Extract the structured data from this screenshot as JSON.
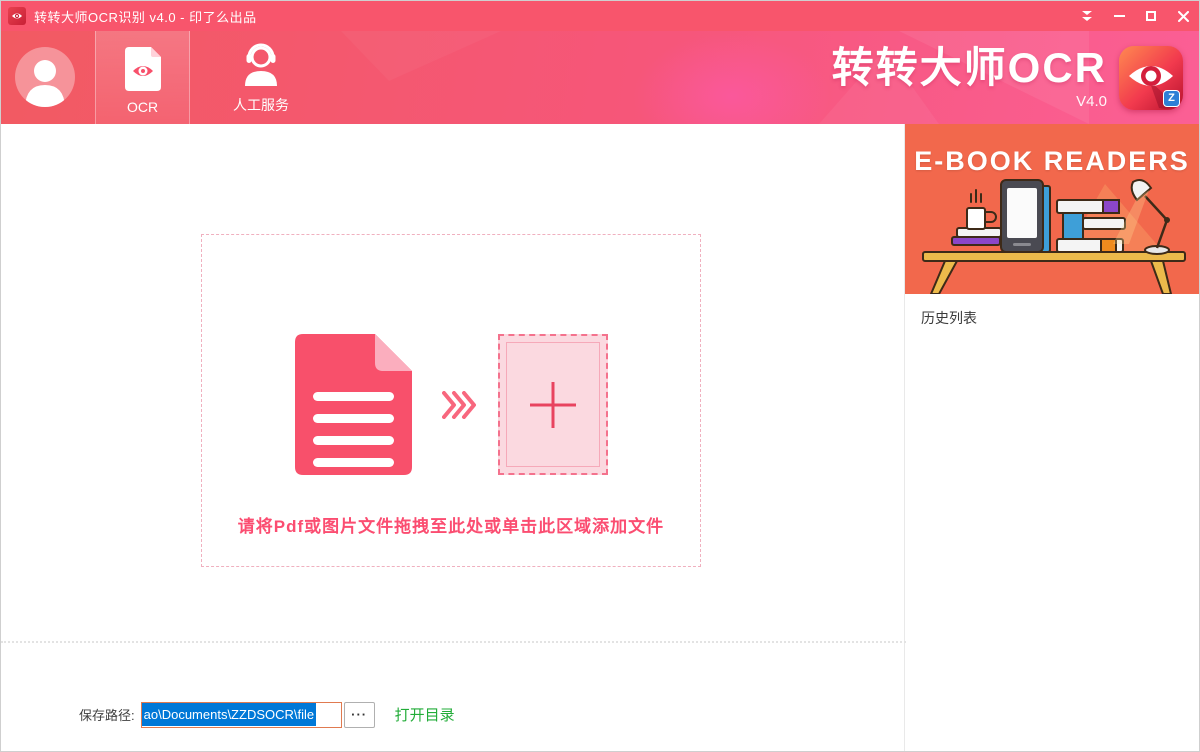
{
  "window": {
    "title": "转转大师OCR识别 v4.0 - 印了么出品",
    "controls": {
      "skin": "skin-menu",
      "minimize": "minimize",
      "maximize": "maximize",
      "close": "close"
    }
  },
  "header": {
    "tabs": [
      {
        "label": "OCR",
        "selected": true
      },
      {
        "label": "人工服务",
        "selected": false
      }
    ],
    "logo_title": "转转大师OCR",
    "logo_version": "V4.0",
    "logo_badge": "Z"
  },
  "dropzone": {
    "hint": "请将Pdf或图片文件拖拽至此处或单击此区域添加文件"
  },
  "footer": {
    "save_path_label": "保存路径:",
    "path_value": "ao\\Documents\\ZZDSOCR\\file",
    "browse_label": "···",
    "open_dir_label": "打开目录"
  },
  "sidebar": {
    "banner_title": "E-BOOK READERS",
    "history_label": "历史列表"
  },
  "colors": {
    "titlebar": "#f8556c",
    "header_gradient_left": "#f25a62",
    "header_gradient_right": "#fb5f95",
    "accent_red": "#f8506b",
    "banner_background": "#f2684c",
    "selection_blue": "#0078d7",
    "link_green": "#22ac38"
  }
}
